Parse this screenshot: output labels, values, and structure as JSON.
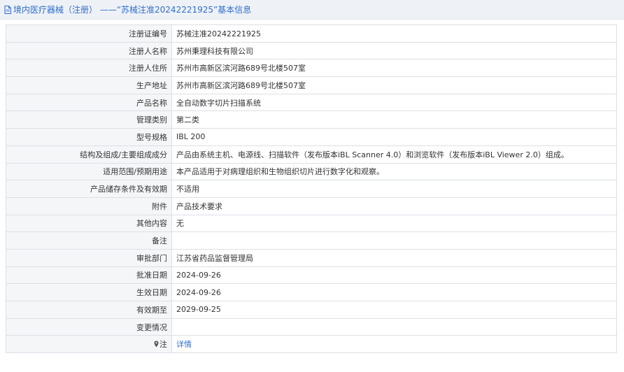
{
  "header": {
    "title": "境内医疗器械（注册） ——“苏械注准20242221925”基本信息",
    "icon": "document-icon"
  },
  "rows": [
    {
      "label": "注册证编号",
      "value": "苏械注准20242221925"
    },
    {
      "label": "注册人名称",
      "value": "苏州秉理科技有限公司"
    },
    {
      "label": "注册人住所",
      "value": "苏州市高新区滨河路689号北楼507室"
    },
    {
      "label": "生产地址",
      "value": "苏州市高新区滨河路689号北楼507室"
    },
    {
      "label": "产品名称",
      "value": "全自动数字切片扫描系统"
    },
    {
      "label": "管理类别",
      "value": "第二类"
    },
    {
      "label": "型号规格",
      "value": "IBL 200"
    },
    {
      "label": "结构及组成/主要组成成分",
      "value": "产品由系统主机、电源线、扫描软件（发布版本iBL Scanner 4.0）和浏览软件（发布版本iBL Viewer 2.0）组成。"
    },
    {
      "label": "适用范围/预期用途",
      "value": "本产品适用于对病理组织和生物组织切片进行数字化和观察。"
    },
    {
      "label": "产品储存条件及有效期",
      "value": "不适用"
    },
    {
      "label": "附件",
      "value": "产品技术要求"
    },
    {
      "label": "其他内容",
      "value": "无"
    },
    {
      "label": "备注",
      "value": ""
    },
    {
      "label": "审批部门",
      "value": "江苏省药品监督管理局"
    },
    {
      "label": "批准日期",
      "value": "2024-09-26"
    },
    {
      "label": "生效日期",
      "value": "2024-09-26"
    },
    {
      "label": "有效期至",
      "value": "2029-09-25"
    },
    {
      "label": "变更情况",
      "value": ""
    }
  ],
  "note": {
    "icon": "pin-icon",
    "label": "注",
    "link": "详情"
  },
  "colors": {
    "link": "#2f6fcf",
    "label_bg": "#f5f6f8",
    "border": "#dcdfe6",
    "header_bg": "#eef1f6"
  }
}
